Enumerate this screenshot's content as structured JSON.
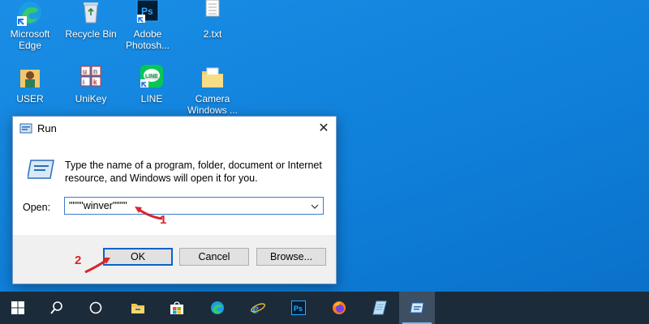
{
  "desktop": {
    "icons": [
      {
        "label": "Microsoft Edge",
        "icon": "edge-icon"
      },
      {
        "label": "Recycle Bin",
        "icon": "recycle-bin-icon"
      },
      {
        "label": "Adobe Photosh...",
        "icon": "photoshop-icon"
      },
      {
        "label": "2.txt",
        "icon": "text-file-icon"
      },
      {
        "label": "USER",
        "icon": "user-folder-icon"
      },
      {
        "label": "UniKey",
        "icon": "unikey-icon"
      },
      {
        "label": "LINE",
        "icon": "line-icon"
      },
      {
        "label": "Camera Windows ...",
        "icon": "folder-icon"
      }
    ]
  },
  "run_dialog": {
    "title": "Run",
    "close_glyph": "✕",
    "description": "Type the name of a program, folder, document or Internet resource, and Windows will open it for you.",
    "open_label": "Open:",
    "open_value": "\"\"\"\"winver\"\"\"\"",
    "ok_label": "OK",
    "cancel_label": "Cancel",
    "browse_label": "Browse..."
  },
  "annotations": {
    "step1": "1",
    "step2": "2",
    "color": "#d8262b"
  },
  "taskbar": {
    "items": [
      "start-icon",
      "search-icon",
      "task-view-icon",
      "file-explorer-icon",
      "microsoft-store-icon",
      "edge-icon",
      "internet-explorer-icon",
      "photoshop-icon",
      "firefox-icon",
      "notepad-icon",
      "run-icon"
    ],
    "active": "run-icon",
    "colors": {
      "bar": "#1c2b3a",
      "accent": "#0a64c8"
    }
  }
}
